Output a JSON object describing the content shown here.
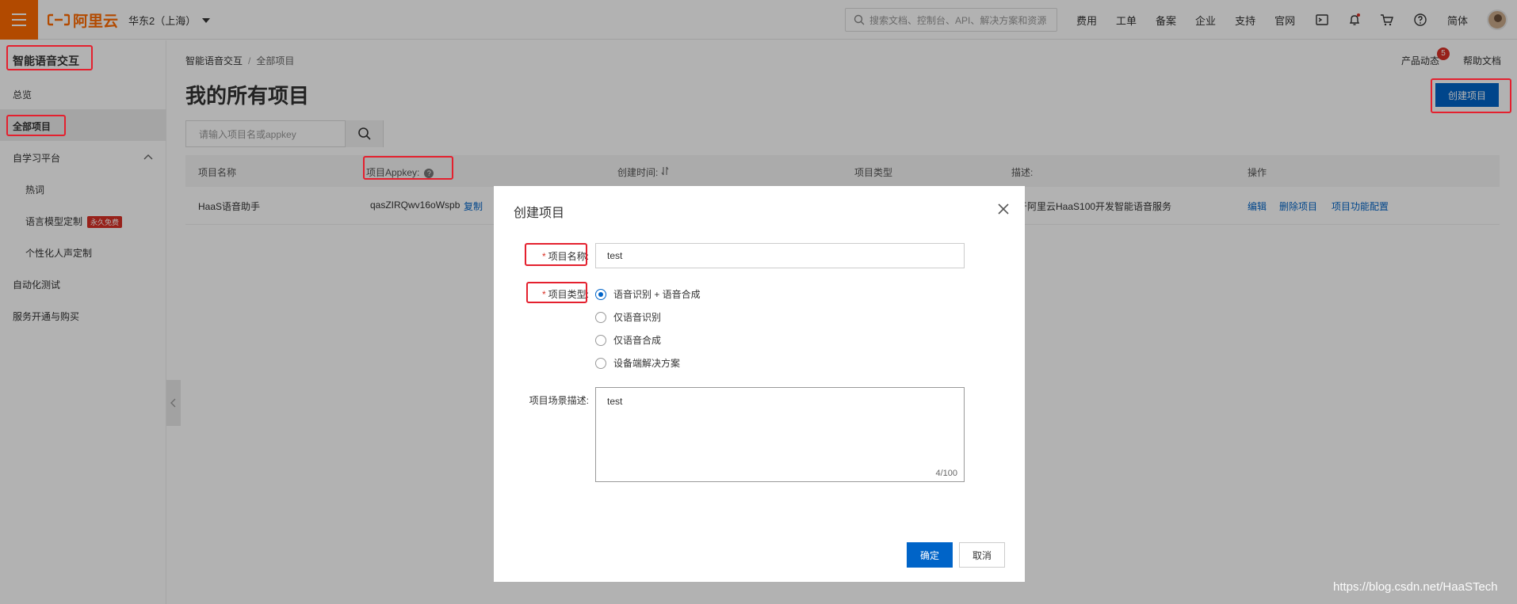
{
  "topbar": {
    "logo_text": "阿里云",
    "region": "华东2（上海）",
    "search_placeholder": "搜索文档、控制台、API、解决方案和资源",
    "nav_links": [
      "费用",
      "工单",
      "备案",
      "企业",
      "支持",
      "官网"
    ],
    "lang": "简体"
  },
  "sidebar": {
    "title": "智能语音交互",
    "items": {
      "overview": "总览",
      "all_projects": "全部项目",
      "self_learning": "自学习平台",
      "hot_words": "热词",
      "lang_model": "语言模型定制",
      "free_badge": "永久免费",
      "personal_voice": "个性化人声定制",
      "auto_test": "自动化测试",
      "service": "服务开通与购买"
    }
  },
  "main": {
    "breadcrumb": {
      "root": "智能语音交互",
      "sep": "/",
      "current": "全部项目"
    },
    "title": "我的所有项目",
    "product_news": "产品动态",
    "product_news_count": "5",
    "help_docs": "帮助文档",
    "create_button": "创建项目",
    "search_placeholder": "请输入项目名或appkey",
    "table": {
      "headers": [
        "项目名称",
        "项目Appkey:",
        "创建时间:",
        "项目类型",
        "描述:",
        "操作"
      ],
      "rows": [
        {
          "name": "HaaS语音助手",
          "appkey": "qasZIRQwv16oWspb",
          "copy": "复制",
          "desc": "于阿里云HaaS100开发智能语音服务",
          "actions": [
            "编辑",
            "删除项目",
            "项目功能配置"
          ]
        }
      ]
    }
  },
  "dialog": {
    "title": "创建项目",
    "name_label": "项目名称:",
    "name_value": "test",
    "type_label": "项目类型:",
    "type_options": [
      "语音识别 + 语音合成",
      "仅语音识别",
      "仅语音合成",
      "设备端解决方案"
    ],
    "type_selected": "语音识别 + 语音合成",
    "desc_label": "项目场景描述:",
    "desc_value": "test",
    "desc_counter": "4/100",
    "ok": "确定",
    "cancel": "取消"
  },
  "watermark": "https://blog.csdn.net/HaaSTech",
  "colors": {
    "brand": "#ff6a00",
    "primary": "#0064c8",
    "highlight": "#e4202e",
    "badge": "#d93026"
  }
}
